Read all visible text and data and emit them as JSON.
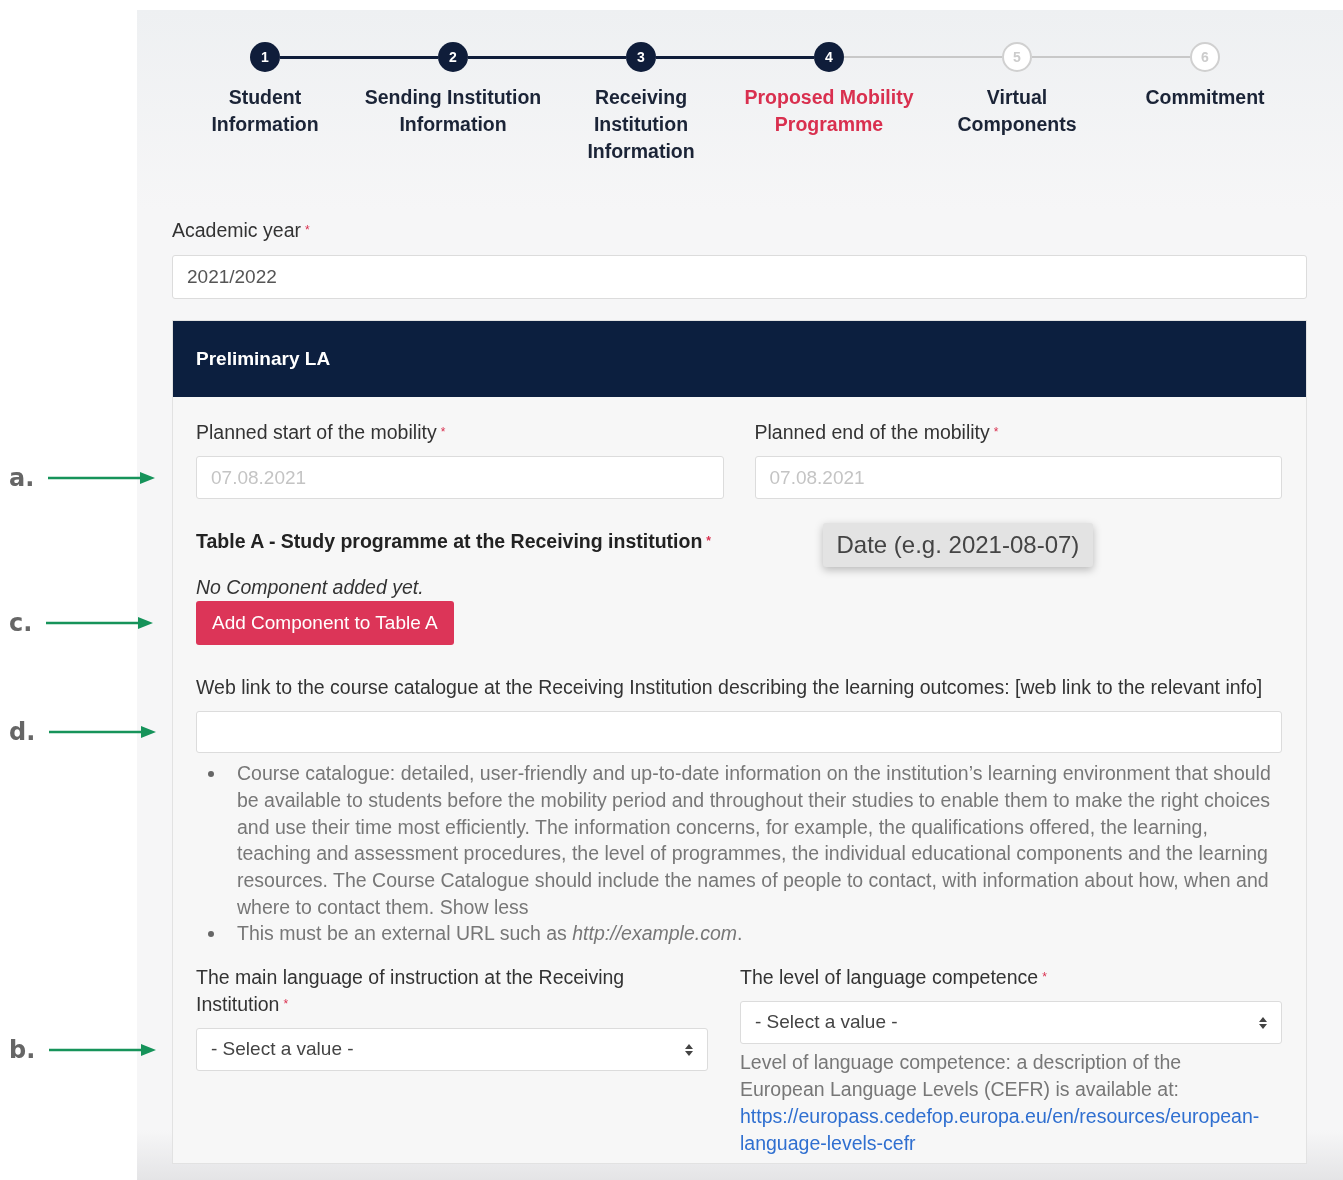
{
  "stepper": [
    {
      "number": "1",
      "label": "Student Information",
      "reached": true,
      "selected": false
    },
    {
      "number": "2",
      "label": "Sending Institution Information",
      "reached": true,
      "selected": false
    },
    {
      "number": "3",
      "label": "Receiving Institution Information",
      "reached": true,
      "selected": false
    },
    {
      "number": "4",
      "label": "Proposed Mobility Programme",
      "reached": true,
      "selected": true
    },
    {
      "number": "5",
      "label": "Virtual Components",
      "reached": false,
      "selected": false
    },
    {
      "number": "6",
      "label": "Commitment",
      "reached": false,
      "selected": false
    }
  ],
  "academic_year": {
    "label": "Academic year",
    "required_mark": "*",
    "value": "2021/2022"
  },
  "panel": {
    "title": "Preliminary LA",
    "start": {
      "label": "Planned start of the mobility",
      "required_mark": "*",
      "placeholder": "07.08.2021",
      "annotation": "a."
    },
    "end": {
      "label": "Planned end of the mobility",
      "required_mark": "*",
      "placeholder": "07.08.2021",
      "tooltip": "Date (e.g. 2021-08-07)"
    },
    "table_a": {
      "title": "Table A - Study programme at the Receiving institution",
      "required_mark": "*",
      "empty_message": "No Component added yet.",
      "button": "Add Component to Table A",
      "annotation": "c."
    },
    "web_link": {
      "label": "Web link to the course catalogue at the Receiving Institution describing the learning outcomes: [web link to the relevant info]",
      "annotation": "d.",
      "help": [
        "Course catalogue: detailed, user-friendly and up-to-date information on the institution’s learning environment that should be available to students before the mobility period and throughout their studies to enable them to make the right choices and use their time most efficiently. The information concerns, for example, the qualifications offered, the learning, teaching and assessment procedures, the level of programmes, the individual educational components and the learning resources. The Course Catalogue should include the names of people to contact, with information about how, when and where to contact them. Show less",
        "This must be an external URL such as *http://example.com*."
      ]
    },
    "main_language": {
      "label": "The main language of instruction at the Receiving Institution",
      "required_mark": "*",
      "value": "- Select a value -",
      "annotation": "b."
    },
    "language_level": {
      "label": "The level of language competence",
      "required_mark": "*",
      "value": "- Select a value -",
      "help": "Level of language competence: a description of the European Language Levels (CEFR) is available at:",
      "help_link": "https://europass.cedefop.europa.eu/en/resources/european-language-levels-cefr"
    }
  }
}
